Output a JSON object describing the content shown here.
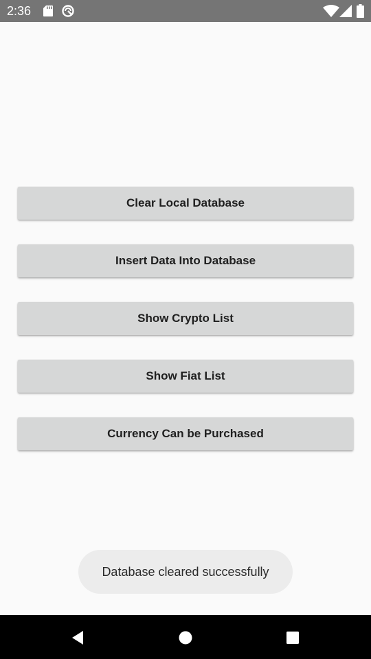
{
  "status_bar": {
    "time": "2:36",
    "icons": [
      "sd-card-icon",
      "data-saver-icon",
      "wifi-icon",
      "signal-icon",
      "battery-icon"
    ]
  },
  "buttons": [
    {
      "label": "Clear Local Database"
    },
    {
      "label": "Insert Data Into Database"
    },
    {
      "label": "Show Crypto List"
    },
    {
      "label": "Show Fiat List"
    },
    {
      "label": "Currency Can be Purchased"
    }
  ],
  "toast": {
    "message": "Database cleared successfully"
  },
  "nav_bar": {
    "icons": [
      "back-icon",
      "home-icon",
      "recents-icon"
    ]
  },
  "colors": {
    "status_bar": "#757575",
    "background": "#fafafa",
    "button": "#d6d7d7",
    "toast": "#ececec",
    "nav_bar": "#000000"
  }
}
